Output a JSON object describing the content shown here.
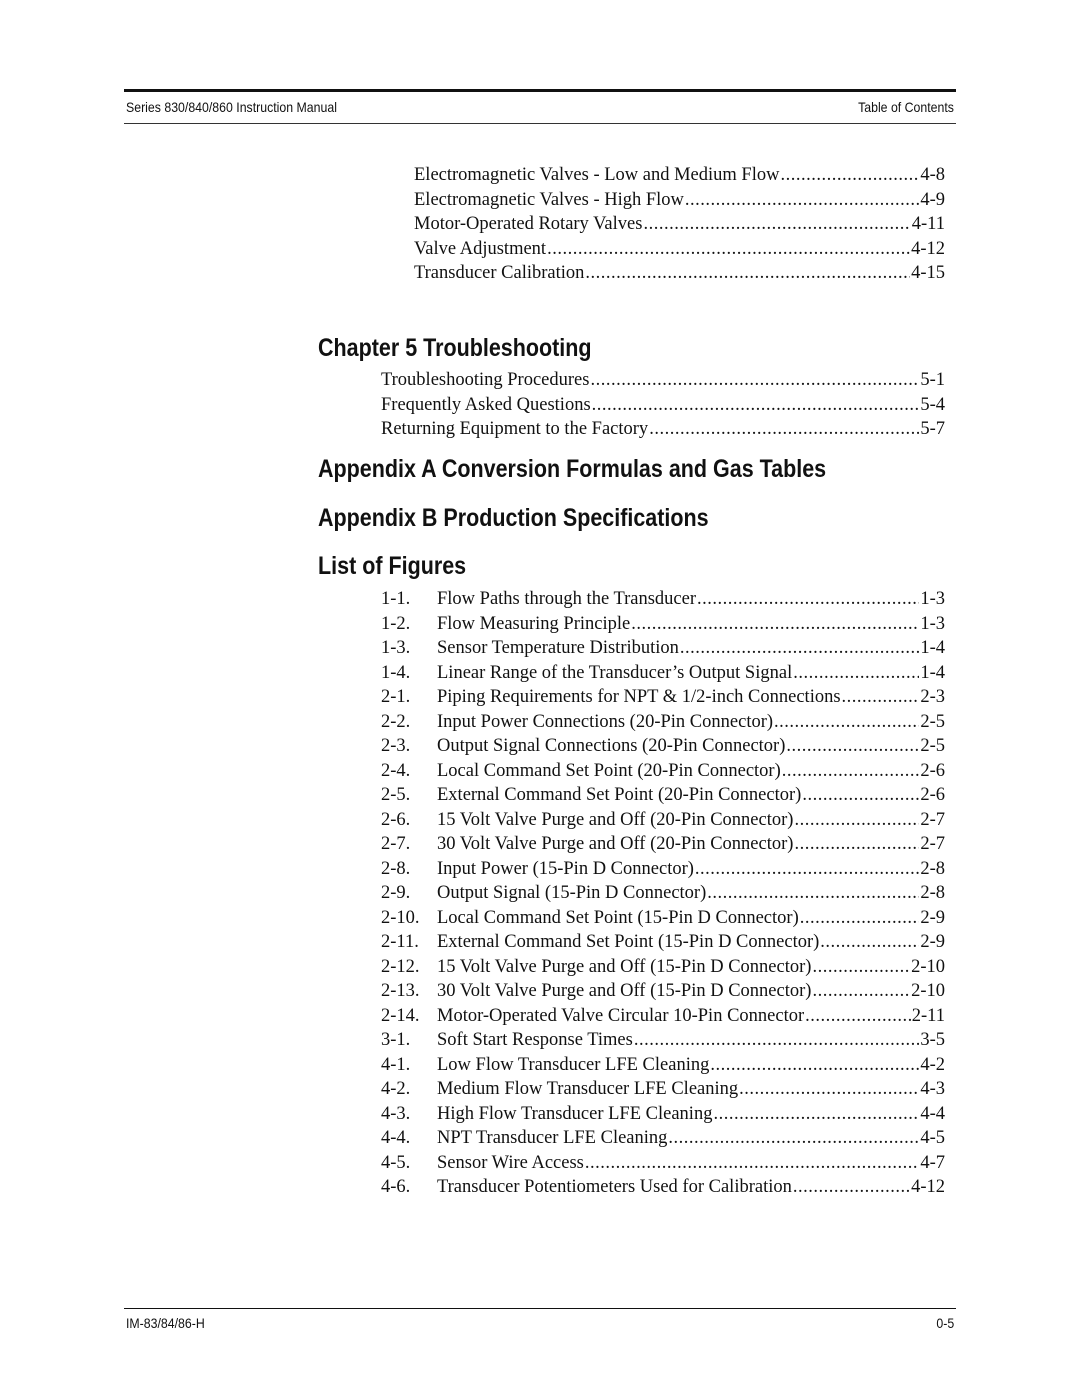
{
  "header": {
    "left": "Series 830/840/860 Instruction Manual",
    "right": "Table of Contents"
  },
  "chapter4_continued": {
    "entries": [
      {
        "title": "Electromagnetic Valves - Low and Medium Flow",
        "page": "4-8"
      },
      {
        "title": "Electromagnetic Valves - High Flow",
        "page": "4-9"
      },
      {
        "title": "Motor-Operated Rotary Valves",
        "page": "4-11"
      },
      {
        "title": "Valve Adjustment",
        "page": "4-12"
      },
      {
        "title": "Transducer Calibration",
        "page": "4-15"
      }
    ]
  },
  "chapter5": {
    "heading": "Chapter 5  Troubleshooting",
    "entries": [
      {
        "title": "Troubleshooting Procedures",
        "page": "5-1"
      },
      {
        "title": "Frequently Asked Questions",
        "page": "5-4"
      },
      {
        "title": "Returning Equipment to the Factory",
        "page": "5-7"
      }
    ]
  },
  "appendix_a": {
    "heading": "Appendix A  Conversion Formulas and Gas Tables"
  },
  "appendix_b": {
    "heading": "Appendix B  Production Specifications"
  },
  "list_of_figures": {
    "heading": "List of Figures",
    "entries": [
      {
        "num": "1-1.",
        "title": "Flow Paths through the Transducer",
        "page": "1-3"
      },
      {
        "num": "1-2.",
        "title": "Flow Measuring Principle",
        "page": "1-3"
      },
      {
        "num": "1-3.",
        "title": "Sensor Temperature Distribution",
        "page": "1-4"
      },
      {
        "num": "1-4.",
        "title": "Linear Range of the Transducer’s Output Signal",
        "page": "1-4"
      },
      {
        "num": "2-1.",
        "title": "Piping Requirements for NPT & 1/2-inch Connections",
        "page": "2-3"
      },
      {
        "num": "2-2.",
        "title": "Input Power Connections (20-Pin Connector)",
        "page": "2-5"
      },
      {
        "num": "2-3.",
        "title": "Output Signal Connections (20-Pin Connector)",
        "page": "2-5"
      },
      {
        "num": "2-4.",
        "title": "Local Command Set Point (20-Pin Connector)",
        "page": "2-6"
      },
      {
        "num": "2-5.",
        "title": "External Command Set Point (20-Pin Connector)",
        "page": "2-6"
      },
      {
        "num": "2-6.",
        "title": "15 Volt Valve Purge and Off (20-Pin Connector)",
        "page": "2-7"
      },
      {
        "num": "2-7.",
        "title": "30 Volt Valve Purge and Off (20-Pin Connector)",
        "page": "2-7"
      },
      {
        "num": "2-8.",
        "title": "Input Power (15-Pin D Connector)",
        "page": "2-8"
      },
      {
        "num": "2-9.",
        "title": "Output Signal (15-Pin D Connector)",
        "page": "2-8"
      },
      {
        "num": "2-10.",
        "title": "Local Command Set Point (15-Pin D Connector)",
        "page": "2-9"
      },
      {
        "num": "2-11.",
        "title": "External Command Set Point (15-Pin D Connector)",
        "page": "2-9"
      },
      {
        "num": "2-12.",
        "title": "15 Volt Valve Purge and Off (15-Pin D Connector)",
        "page": "2-10"
      },
      {
        "num": "2-13.",
        "title": "30 Volt Valve Purge and Off (15-Pin D Connector)",
        "page": "2-10"
      },
      {
        "num": "2-14.",
        "title": "Motor-Operated Valve Circular 10-Pin Connector",
        "page": "2-11"
      },
      {
        "num": "3-1.",
        "title": "Soft Start Response Times",
        "page": "3-5"
      },
      {
        "num": "4-1.",
        "title": "Low Flow Transducer LFE Cleaning",
        "page": "4-2"
      },
      {
        "num": "4-2.",
        "title": "Medium Flow Transducer LFE Cleaning",
        "page": "4-3"
      },
      {
        "num": "4-3.",
        "title": "High Flow Transducer LFE Cleaning",
        "page": "4-4"
      },
      {
        "num": "4-4.",
        "title": "NPT Transducer LFE Cleaning",
        "page": "4-5"
      },
      {
        "num": "4-5.",
        "title": "Sensor Wire Access",
        "page": "4-7"
      },
      {
        "num": "4-6.",
        "title": "Transducer Potentiometers Used for Calibration",
        "page": "4-12"
      }
    ]
  },
  "footer": {
    "left": "IM-83/84/86-H",
    "right": "0-5"
  }
}
